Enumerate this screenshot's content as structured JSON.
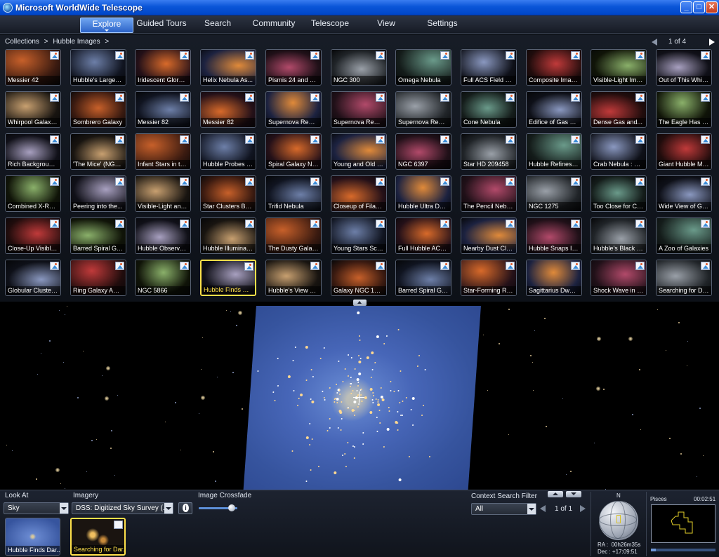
{
  "window": {
    "title": "Microsoft WorldWide Telescope"
  },
  "window_controls": {
    "minimize": "_",
    "maximize": "□",
    "close": "✕"
  },
  "menu": {
    "items": [
      {
        "label": "Explore",
        "active": true
      },
      {
        "label": "Guided Tours"
      },
      {
        "label": "Search"
      },
      {
        "label": "Community"
      },
      {
        "label": "Telescope"
      },
      {
        "label": "View"
      },
      {
        "label": "Settings"
      }
    ]
  },
  "breadcrumb": {
    "root": "Collections",
    "sep": ">",
    "current": "Hubble Images",
    "trail": ">"
  },
  "pager": {
    "text": "1 of 4"
  },
  "thumbnails": [
    [
      "Messier 42",
      "Hubble's Largest...",
      "Iridescent Glory o...",
      "Helix Nebula As...",
      "Pismis 24 and N...",
      "NGC 300",
      "Omega Nebula",
      "Full ACS Field of...",
      "Composite Image...",
      "Visible-Light Ima...",
      "Out of This Whirl..."
    ],
    [
      "Whirpool Galaxy...",
      "Sombrero Galaxy",
      "Messier 82",
      "Messier 82",
      "Supernova Remn...",
      "Supernova Remn...",
      "Supernova Remn...",
      "Cone Nebula",
      "Edifice of Gas an...",
      "Dense Gas and...",
      "The Eagle Has Ri..."
    ],
    [
      "Rich Background...",
      "'The Mice' (NGC...",
      "Infant Stars in the...",
      "Hubble Probes th...",
      "Spiral Galaxy NG...",
      "Young and Old St...",
      "NGC 6397",
      "Star HD 209458",
      "Hubble Refines D...",
      "Crab Nebula : De...",
      "Giant Hubble Mo..."
    ],
    [
      "Combined X-Ray...",
      "Peering into the...",
      "Visible-Light and...",
      "Star Clusters Bor...",
      "Trifid Nebula",
      "Closeup of Filam...",
      "Hubble Ultra Dee...",
      "The Pencil Nebul...",
      "NGC 1275",
      "Too Close for Co...",
      "Wide View of Gia..."
    ],
    [
      "Close-Up Visible...",
      "Barred Spiral Gal...",
      "Hubble Observes...",
      "Hubble Illuminate...",
      "The Dusty Galax...",
      "Young Stars Scul...",
      "Full Hubble ACS...",
      "Nearby Dust Clo...",
      "Hubble Snaps Im...",
      "Hubble's Black a...",
      "A Zoo of Galaxies"
    ],
    [
      "Globular Cluster...",
      "Ring Galaxy AM...",
      "NGC 5866",
      "Hubble Finds Dar...",
      "Hubble's View of...",
      "Galaxy NGC 142...",
      "Barred Spiral Gal...",
      "Star-Forming Re...",
      "Sagittarius Dwarf...",
      "Shock Wave in K...",
      "Searching for Dar..."
    ]
  ],
  "selected_thumbnail": "Hubble Finds Dar...",
  "bottom": {
    "look_at": {
      "label": "Look At",
      "value": "Sky"
    },
    "imagery": {
      "label": "Imagery",
      "value": "DSS: Digitized Sky Survey (..."
    },
    "crossfade": {
      "label": "Image Crossfade",
      "level": 0.85
    },
    "recent": [
      {
        "label": "Hubble Finds Dar...",
        "selected": false
      },
      {
        "label": "Searching for Dar...",
        "selected": true
      }
    ],
    "context_filter": {
      "label": "Context Search Filter",
      "value": "All",
      "pager": "1 of 1"
    },
    "compass": {
      "north": "N",
      "ra": "RA :  00h26m35s",
      "dec": "Dec : +17:09:51"
    },
    "finder": {
      "constellation": "Pisces",
      "time": "00:02:51",
      "progress": 0.08
    }
  }
}
